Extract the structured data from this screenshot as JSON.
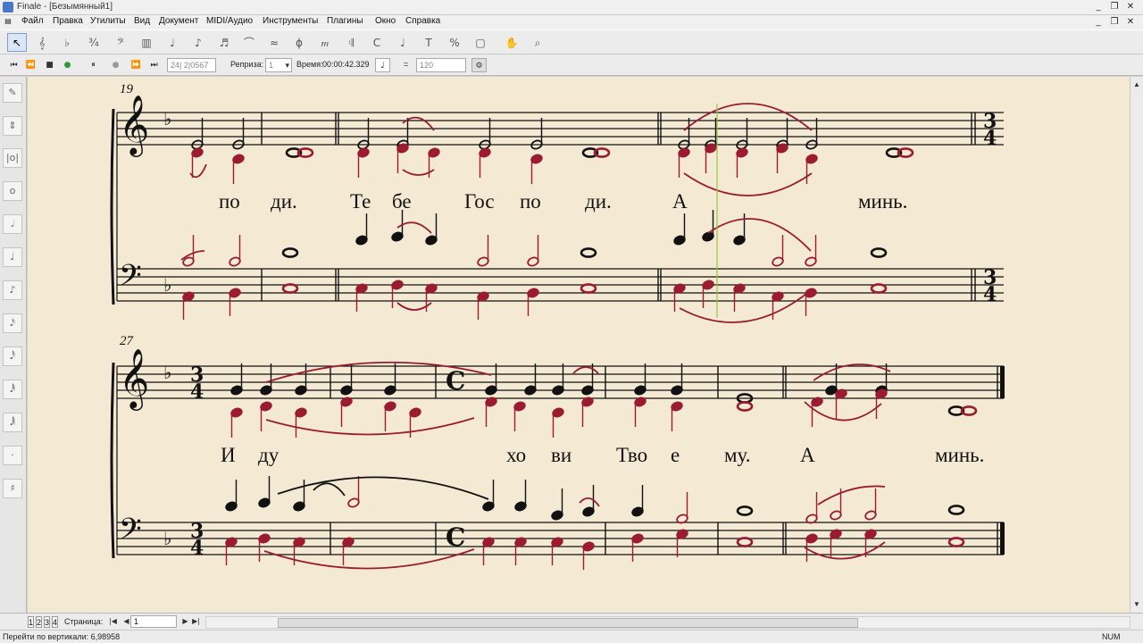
{
  "window": {
    "title": "Finale - [Безымянный1]"
  },
  "menu": [
    "Файл",
    "Правка",
    "Утилиты",
    "Вид",
    "Документ",
    "MIDI/Аудио",
    "Инструменты",
    "Плагины",
    "Окно",
    "Справка"
  ],
  "toolbar_icons": [
    "selection-tool",
    "staff-tool",
    "key-signature-tool",
    "time-signature-tool",
    "clef-tool",
    "measure-tool",
    "simple-entry-tool",
    "speedy-entry-tool",
    "tuplet-tool",
    "smart-shape-tool",
    "articulation-tool",
    "expression-tool",
    "repeat-tool",
    "chord-tool",
    "lyrics-tool",
    "text-tool",
    "resize-tool",
    "special-tools",
    "hand-grabber-tool",
    "zoom-tool"
  ],
  "playback": {
    "counter": "24| 2|0567",
    "repeat_label": "Реприза:",
    "repeat_value": "1",
    "time_label": "Время:",
    "time_value": "00:00:42.329",
    "tempo_equals": "=",
    "tempo_value": "120"
  },
  "palette_icons": [
    "eraser-icon",
    "half-step-icon",
    "breve-icon",
    "whole-note-icon",
    "half-note-icon",
    "quarter-note-icon",
    "eighth-note-icon",
    "sixteenth-note-icon",
    "thirty-second-note-icon",
    "sixty-fourth-note-icon",
    "128th-note-icon",
    "dot-icon",
    "sharp-icon"
  ],
  "score": {
    "system1": {
      "measure_number": "19",
      "time_signature": "3/4",
      "lyrics": [
        "по",
        "ди.",
        "Те",
        "бе",
        "Гос",
        "по",
        "ди.",
        "А",
        "минь."
      ]
    },
    "system2": {
      "measure_number": "27",
      "time_signature": "3/4",
      "lyrics": [
        "И",
        "ду",
        "хо",
        "ви",
        "Тво",
        "е",
        "му.",
        "А",
        "минь."
      ]
    },
    "colors": {
      "played_note": "#9b1b30",
      "staff": "#111111",
      "paper": "#f4ead4"
    }
  },
  "pagebar": {
    "page_tabs": [
      "1",
      "2",
      "3",
      "4"
    ],
    "page_label": "Страница:",
    "page_value": "1"
  },
  "status": {
    "message": "Перейти по вертикали: 6,98958",
    "indicator": "NUM"
  }
}
